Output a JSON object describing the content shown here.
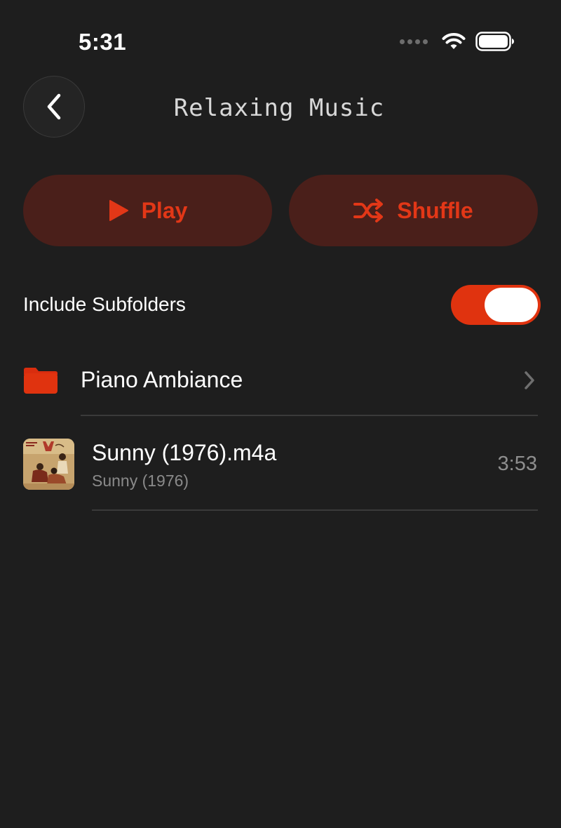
{
  "status_bar": {
    "time": "5:31"
  },
  "header": {
    "title": "Relaxing Music",
    "back_icon": "chevron-left-icon"
  },
  "actions": {
    "play_label": "Play",
    "shuffle_label": "Shuffle"
  },
  "settings": {
    "include_subfolders_label": "Include Subfolders",
    "include_subfolders_on": true
  },
  "folders": [
    {
      "name": "Piano Ambiance",
      "icon": "folder-icon"
    }
  ],
  "tracks": [
    {
      "title": "Sunny (1976).m4a",
      "subtitle": "Sunny (1976)",
      "duration": "3:53"
    }
  ],
  "colors": {
    "background": "#1e1e1e",
    "accent": "#e0330f",
    "button_background": "#4a1f1a"
  }
}
